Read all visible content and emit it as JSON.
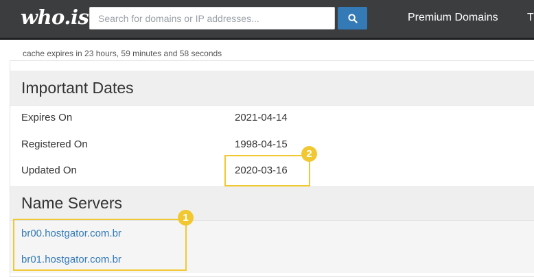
{
  "header": {
    "logo_text": "who.is",
    "search_placeholder": "Search for domains or IP addresses...",
    "search_icon": "search-icon",
    "nav": [
      "Premium Domains",
      "T"
    ]
  },
  "cache_notice": "cache expires in 23 hours, 59 minutes and 58 seconds",
  "important_dates": {
    "title": "Important Dates",
    "rows": [
      {
        "label": "Expires On",
        "value": "2021-04-14"
      },
      {
        "label": "Registered On",
        "value": "1998-04-15"
      },
      {
        "label": "Updated On",
        "value": "2020-03-16"
      }
    ]
  },
  "name_servers": {
    "title": "Name Servers",
    "items": [
      "br00.hostgator.com.br",
      "br01.hostgator.com.br"
    ]
  },
  "annotations": {
    "badge_1": "1",
    "badge_2": "2",
    "highlight_color": "#f2c832"
  }
}
